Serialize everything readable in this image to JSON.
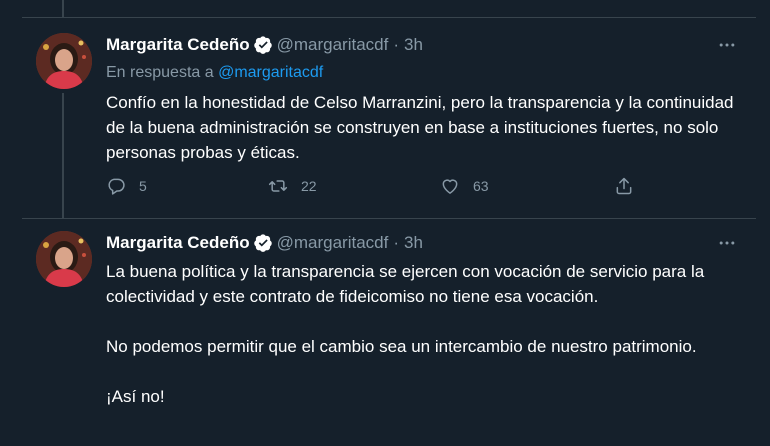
{
  "tweets": [
    {
      "author": {
        "name": "Margarita Cedeño",
        "handle": "@margaritacdf",
        "time": "3h",
        "separator": "·"
      },
      "reply_prefix": "En respuesta a",
      "reply_handle": "@margaritacdf",
      "paragraphs": [
        "Confío en la honestidad de Celso Marranzini, pero la transparencia y la continuidad de la buena administración se construyen en base a instituciones fuertes, no solo personas probas y éticas."
      ],
      "stats": {
        "replies": "5",
        "retweets": "22",
        "likes": "63"
      },
      "icons": [
        "verified-badge-icon",
        "more-icon",
        "reply-icon",
        "retweet-icon",
        "like-icon",
        "share-icon"
      ]
    },
    {
      "author": {
        "name": "Margarita Cedeño",
        "handle": "@margaritacdf",
        "time": "3h",
        "separator": "·"
      },
      "paragraphs": [
        "La buena política y la transparencia se ejercen con vocación de servicio para la colectividad  y este contrato de fideicomiso no tiene esa vocación.",
        "No podemos permitir que el cambio sea un intercambio de nuestro patrimonio.",
        "¡Así no!"
      ],
      "icons": [
        "verified-badge-icon",
        "more-icon"
      ]
    }
  ],
  "colors": {
    "background": "#15202b",
    "border": "#38444d",
    "secondary_text": "#8899a6",
    "link": "#1d9bf0",
    "verified": "#ffffff"
  }
}
